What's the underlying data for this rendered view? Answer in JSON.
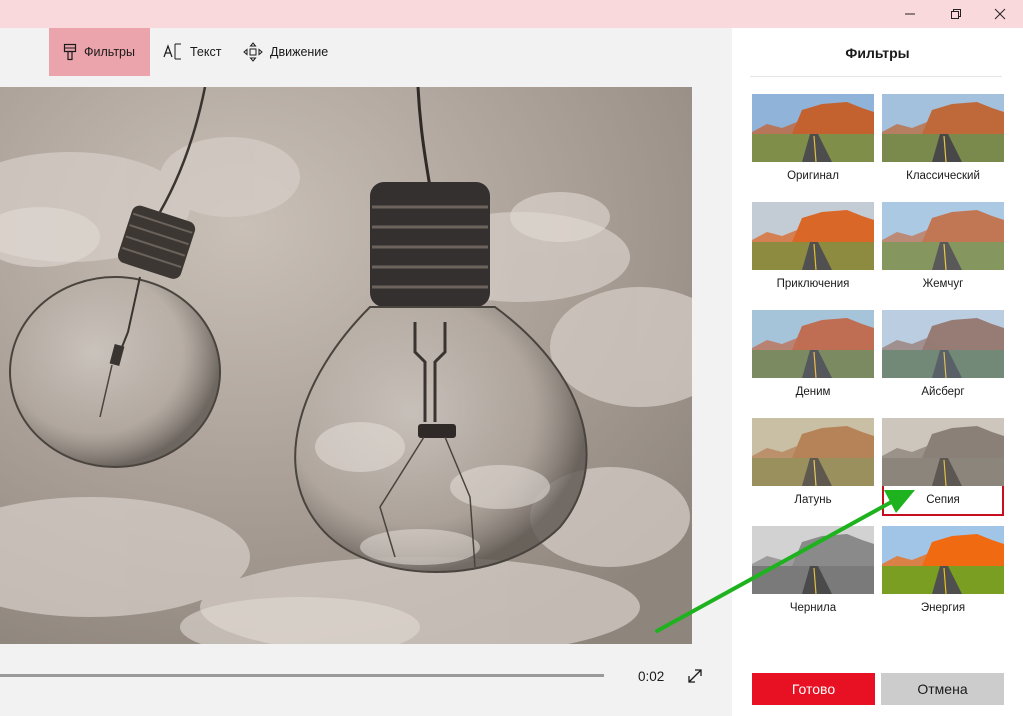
{
  "window": {
    "controls": [
      "minimize",
      "restore",
      "close"
    ]
  },
  "toolbar": {
    "tabs": [
      {
        "label": "Фильтры",
        "icon": "brush-icon",
        "active": true
      },
      {
        "label": "Текст",
        "icon": "text-icon",
        "active": false
      },
      {
        "label": "Движение",
        "icon": "motion-icon",
        "active": false
      }
    ]
  },
  "player": {
    "time": "0:02",
    "expand_icon": "expand-icon"
  },
  "panel": {
    "title": "Фильтры",
    "filters": [
      {
        "label": "Оригинал",
        "style": "original"
      },
      {
        "label": "Классический",
        "style": "classic"
      },
      {
        "label": "Приключения",
        "style": "adventure"
      },
      {
        "label": "Жемчуг",
        "style": "pearl"
      },
      {
        "label": "Деним",
        "style": "denim"
      },
      {
        "label": "Айсберг",
        "style": "iceberg"
      },
      {
        "label": "Латунь",
        "style": "brass"
      },
      {
        "label": "Сепия",
        "style": "sepia"
      },
      {
        "label": "Чернила",
        "style": "ink"
      },
      {
        "label": "Энергия",
        "style": "energy"
      }
    ],
    "selected_filter": "Сепия",
    "done_label": "Готово",
    "cancel_label": "Отмена"
  },
  "colors": {
    "titlebar": "#f9d9dc",
    "active_tab": "#eba4ab",
    "accent": "#e81123",
    "selection_border": "#c50f1f",
    "annotation_arrow": "#1eb31e"
  }
}
